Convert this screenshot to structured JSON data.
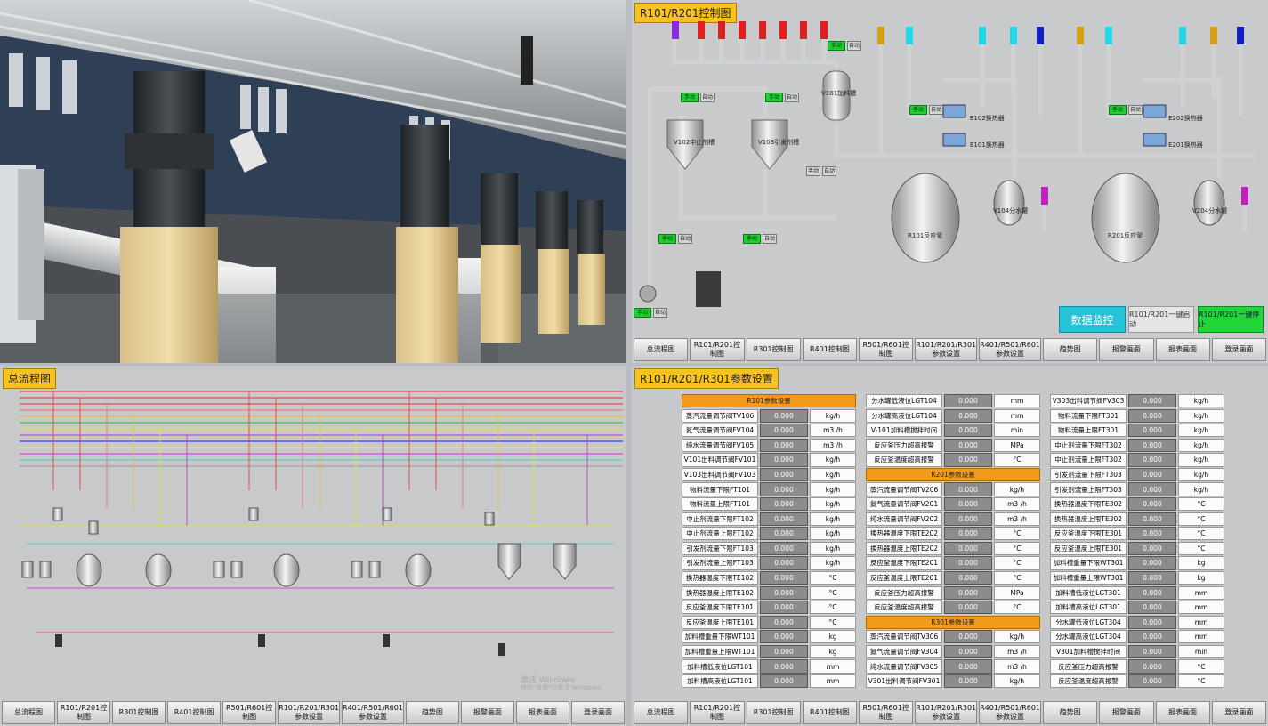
{
  "nav_labels": [
    "总流程图",
    "R101/R201控制图",
    "R301控制图",
    "R401控制图",
    "R501/R601控制图",
    "R101/R201/R301\n参数设置",
    "R401/R501/R601\n参数设置",
    "趋势图",
    "报警画面",
    "报表画面",
    "登录画面"
  ],
  "nav_labels_param": [
    "总流程图",
    "R101/R201控制图",
    "R301控制图",
    "R401控制图",
    "R501/R601控制图",
    "R101/R201/R301\n参数设置",
    "R401/R501/R601\n参数设置",
    "趋势图",
    "报警画面",
    "报表画面",
    "登录画面"
  ],
  "control": {
    "title": "R101/R201控制图",
    "monitor_label": "数据监控",
    "start_label": "R101/R201一键启动",
    "stop_label": "R101/R201一键停止",
    "reactor_1": "R101反应釜",
    "reactor_2": "R201反应釜",
    "tank_v104": "V104分水罐",
    "tank_v204": "V204分水罐",
    "tank_v101": "V101加料槽",
    "tank_v102": "V102中止剂槽",
    "tank_v103": "V103引发剂槽",
    "exch_e101": "E101换热器",
    "exch_e102": "E102换热器",
    "exch_e201": "E201换热器",
    "exch_e202": "E202换热器",
    "hand": "手动",
    "auto": "自动"
  },
  "flow": {
    "title": "总流程图",
    "watermark_1": "激活 Windows",
    "watermark_2": "转到\"设置\"以激活 Windows。"
  },
  "params": {
    "title": "R101/R201/R301参数设置",
    "value_default": "0.000",
    "col1": [
      {
        "header": "R101参数设置"
      },
      {
        "label": "蒸汽流量调节阀TV106",
        "unit": "kg/h"
      },
      {
        "label": "氮气流量调节阀FV104",
        "unit": "m3 /h"
      },
      {
        "label": "纯水流量调节阀FV105",
        "unit": "m3 /h"
      },
      {
        "label": "V101出料调节阀FV101",
        "unit": "kg/h"
      },
      {
        "label": "V103出料调节阀FV103",
        "unit": "kg/h"
      },
      {
        "label": "物料流量下限FT101",
        "unit": "kg/h"
      },
      {
        "label": "物料流量上限FT101",
        "unit": "kg/h"
      },
      {
        "label": "中止剂流量下限FT102",
        "unit": "kg/h"
      },
      {
        "label": "中止剂流量上限FT102",
        "unit": "kg/h"
      },
      {
        "label": "引发剂流量下限FT103",
        "unit": "kg/h"
      },
      {
        "label": "引发剂流量上限FT103",
        "unit": "kg/h"
      },
      {
        "label": "换热器温度下限TE102",
        "unit": "°C"
      },
      {
        "label": "换热器温度上限TE102",
        "unit": "°C"
      },
      {
        "label": "反应釜温度下限TE101",
        "unit": "°C"
      },
      {
        "label": "反应釜温度上限TE101",
        "unit": "°C"
      },
      {
        "label": "加料槽重量下限WT101",
        "unit": "kg"
      },
      {
        "label": "加料槽重量上限WT101",
        "unit": "kg"
      },
      {
        "label": "加料槽低液位LGT101",
        "unit": "mm"
      },
      {
        "label": "加料槽高液位LGT101",
        "unit": "mm"
      }
    ],
    "col2": [
      {
        "label": "分水罐低液位LGT104",
        "unit": "mm"
      },
      {
        "label": "分水罐高液位LGT104",
        "unit": "mm"
      },
      {
        "label": "V-101加料槽搅拌时间",
        "unit": "min"
      },
      {
        "label": "反应釜压力超高报警",
        "unit": "MPa"
      },
      {
        "label": "反应釜温度超高报警",
        "unit": "°C"
      },
      {
        "header": "R201参数设置"
      },
      {
        "label": "蒸汽流量调节阀TV206",
        "unit": "kg/h"
      },
      {
        "label": "氮气流量调节阀FV201",
        "unit": "m3 /h"
      },
      {
        "label": "纯水流量调节阀FV202",
        "unit": "m3 /h"
      },
      {
        "label": "换热器温度下限TE202",
        "unit": "°C"
      },
      {
        "label": "换热器温度上限TE202",
        "unit": "°C"
      },
      {
        "label": "反应釜温度下限TE201",
        "unit": "°C"
      },
      {
        "label": "反应釜温度上限TE201",
        "unit": "°C"
      },
      {
        "label": "反应釜压力超高报警",
        "unit": "MPa"
      },
      {
        "label": "反应釜温度超高报警",
        "unit": "°C"
      },
      {
        "header": "R301参数设置"
      },
      {
        "label": "蒸汽流量调节阀TV306",
        "unit": "kg/h"
      },
      {
        "label": "氮气流量调节阀FV304",
        "unit": "m3 /h"
      },
      {
        "label": "纯水流量调节阀FV305",
        "unit": "m3 /h"
      },
      {
        "label": "V301出料调节阀FV301",
        "unit": "kg/h"
      }
    ],
    "col3": [
      {
        "label": "V303出料调节阀FV303",
        "unit": "kg/h"
      },
      {
        "label": "物料流量下限FT301",
        "unit": "kg/h"
      },
      {
        "label": "物料流量上限FT301",
        "unit": "kg/h"
      },
      {
        "label": "中止剂流量下限FT302",
        "unit": "kg/h"
      },
      {
        "label": "中止剂流量上限FT302",
        "unit": "kg/h"
      },
      {
        "label": "引发剂流量下限FT303",
        "unit": "kg/h"
      },
      {
        "label": "引发剂流量上限FT303",
        "unit": "kg/h"
      },
      {
        "label": "换热器温度下限TE302",
        "unit": "°C"
      },
      {
        "label": "换热器温度上限TE302",
        "unit": "°C"
      },
      {
        "label": "反应釜温度下限TE301",
        "unit": "°C"
      },
      {
        "label": "反应釜温度上限TE301",
        "unit": "°C"
      },
      {
        "label": "加料槽重量下限WT301",
        "unit": "kg"
      },
      {
        "label": "加料槽重量上限WT301",
        "unit": "kg"
      },
      {
        "label": "加料槽低液位LGT301",
        "unit": "mm"
      },
      {
        "label": "加料槽高液位LGT301",
        "unit": "mm"
      },
      {
        "label": "分水罐低液位LGT304",
        "unit": "mm"
      },
      {
        "label": "分水罐高液位LGT304",
        "unit": "mm"
      },
      {
        "label": "V301加料槽搅拌时间",
        "unit": "min"
      },
      {
        "label": "反应釜压力超高报警",
        "unit": "°C"
      },
      {
        "label": "反应釜温度超高报警",
        "unit": "°C"
      }
    ]
  },
  "colors": {
    "title_tag": "#f7c21e",
    "param_header": "#f49a1b",
    "monitor_button": "#23c4d8",
    "stop_button": "#22d63a",
    "hand_button": "#1fcf2d"
  }
}
